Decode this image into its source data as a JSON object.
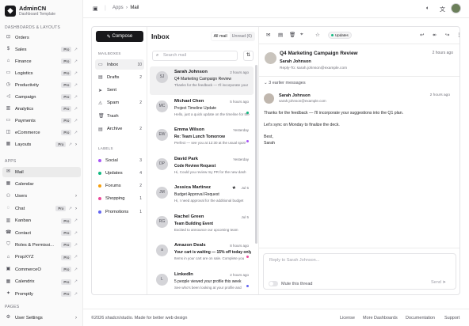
{
  "brand": {
    "name": "AdminCN",
    "sub": "Dashboard Template"
  },
  "sidebar": {
    "sec1": "DASHBOARDS & LAYOUTS",
    "sec2": "APPS",
    "sec3": "PAGES",
    "items": [
      {
        "label": "Orders",
        "icon": "cart-icon"
      },
      {
        "label": "Sales",
        "icon": "dollar-icon",
        "pro": "Pro"
      },
      {
        "label": "Finance",
        "icon": "bank-icon",
        "pro": "Pro"
      },
      {
        "label": "Logistics",
        "icon": "truck-icon",
        "pro": "Pro"
      },
      {
        "label": "Productivity",
        "icon": "clock-icon",
        "pro": "Pro"
      },
      {
        "label": "Campaign",
        "icon": "megaphone-icon",
        "pro": "Pro"
      },
      {
        "label": "Analytics",
        "icon": "chart-icon",
        "pro": "Pro"
      },
      {
        "label": "Payments",
        "icon": "card-icon",
        "pro": "Pro"
      },
      {
        "label": "eCommerce",
        "icon": "bag-icon",
        "pro": "Pro"
      },
      {
        "label": "Layouts",
        "icon": "layout-icon",
        "pro": "Pro"
      }
    ],
    "apps": [
      {
        "label": "Mail",
        "icon": "mail-icon"
      },
      {
        "label": "Calendar",
        "icon": "calendar-icon"
      },
      {
        "label": "Users",
        "icon": "users-icon"
      },
      {
        "label": "Chat",
        "icon": "chat-icon",
        "pro": "Pro"
      },
      {
        "label": "Kanban",
        "icon": "kanban-icon",
        "pro": "Pro"
      },
      {
        "label": "Contact",
        "icon": "contact-icon",
        "pro": "Pro"
      },
      {
        "label": "Roles & Permissi...",
        "icon": "shield-icon",
        "pro": "Pro"
      },
      {
        "label": "PropXYZ",
        "icon": "home-icon",
        "pro": "Pro"
      },
      {
        "label": "CommerceO",
        "icon": "store-icon",
        "pro": "Pro"
      },
      {
        "label": "Calendrix",
        "icon": "calendar-icon",
        "pro": "Pro"
      },
      {
        "label": "Promptly",
        "icon": "sparkle-icon",
        "pro": "Pro"
      }
    ],
    "pages": [
      {
        "label": "User Settings",
        "icon": "settings-icon"
      }
    ]
  },
  "topbar": {
    "crumb1": "Apps",
    "crumb2": "Mail"
  },
  "mail": {
    "compose": "Compose",
    "mailboxes_h": "MAILBOXES",
    "mailboxes": [
      {
        "label": "Inbox",
        "count": "10"
      },
      {
        "label": "Drafts",
        "count": "2"
      },
      {
        "label": "Sent",
        "count": ""
      },
      {
        "label": "Spam",
        "count": "2"
      },
      {
        "label": "Trash",
        "count": ""
      },
      {
        "label": "Archive",
        "count": "2"
      }
    ],
    "labels_h": "LABELS",
    "labels": [
      {
        "label": "Social",
        "count": "3",
        "color": "#a855f7"
      },
      {
        "label": "Updates",
        "count": "4",
        "color": "#10b981"
      },
      {
        "label": "Forums",
        "count": "2",
        "color": "#f59e0b"
      },
      {
        "label": "Shopping",
        "count": "1",
        "color": "#ec4899"
      },
      {
        "label": "Promotions",
        "count": "1",
        "color": "#6366f1"
      }
    ],
    "inbox_title": "Inbox",
    "tab_all": "All mail",
    "tab_unread": "Unread (6)",
    "search_ph": "Search mail",
    "rows": [
      {
        "name": "Sarah Johnson",
        "date": "2 hours ago",
        "subject": "Q4 Marketing Campaign Review",
        "preview": "Thanks for the feedback — I'll incorporate your",
        "avatar": "SJ",
        "bold": false,
        "dot": ""
      },
      {
        "name": "Michael Chen",
        "date": "5 hours ago",
        "subject": "Project Timeline Update",
        "preview": "Hello, just a quick update on the timeline for the",
        "avatar": "MC",
        "bold": false,
        "dot": "#10b981"
      },
      {
        "name": "Emma Wilson",
        "date": "Yesterday",
        "subject": "Re: Team Lunch Tomorrow",
        "preview": "Perfect — see you at 12:30 at the usual spot!",
        "avatar": "EW",
        "bold": true,
        "dot": "#a855f7"
      },
      {
        "name": "David Park",
        "date": "Yesterday",
        "subject": "Code Review Request",
        "preview": "Hi, Could you review my PR for the new dash",
        "avatar": "DP",
        "bold": true,
        "dot": ""
      },
      {
        "name": "Jessica Martinez",
        "date": "Jul 5",
        "subject": "Budget Approval Request",
        "preview": "Hi, I need approval for the additional budget",
        "avatar": "JM",
        "bold": false,
        "dot": "",
        "star": true
      },
      {
        "name": "Rachel Green",
        "date": "Jul 5",
        "subject": "Team Building Event",
        "preview": "Excited to announce our upcoming team",
        "avatar": "RG",
        "bold": true,
        "dot": ""
      },
      {
        "name": "Amazon Deals",
        "date": "8 hours ago",
        "subject": "Your cart is waiting — 15% off today only",
        "preview": "Items in your cart are on sale. Complete you",
        "avatar": "a",
        "bold": true,
        "dot": "#ec4899"
      },
      {
        "name": "LinkedIn",
        "date": "2 hours ago",
        "subject": "5 people viewed your profile this week",
        "preview": "See who's been looking at your profile and",
        "avatar": "L",
        "bold": false,
        "dot": "#6366f1"
      }
    ],
    "detail": {
      "badge": "Updates",
      "subject": "Q4 Marketing Campaign Review",
      "subject_date": "2 hours ago",
      "from": "Sarah Johnson",
      "reply_to": "Reply-To: sarah.johnson@example.com",
      "earlier": "3 earlier messages",
      "msg_name": "Sarah Johnson",
      "msg_email": "sarah.johnson@example.com",
      "msg_date": "2 hours ago",
      "body1": "Thanks for the feedback — I'll incorporate your suggestions into the Q1 plan.",
      "body2": "Let's sync on Monday to finalize the deck.",
      "body3": "Best,",
      "body4": "Sarah",
      "reply_ph": "Reply to Sarah Johnson...",
      "mute": "Mute this thread",
      "send": "Send"
    }
  },
  "footer": {
    "copy": "©2026 shadcn/studio. Made for better web design",
    "l1": "License",
    "l2": "More Dashboards",
    "l3": "Documentation",
    "l4": "Support"
  }
}
